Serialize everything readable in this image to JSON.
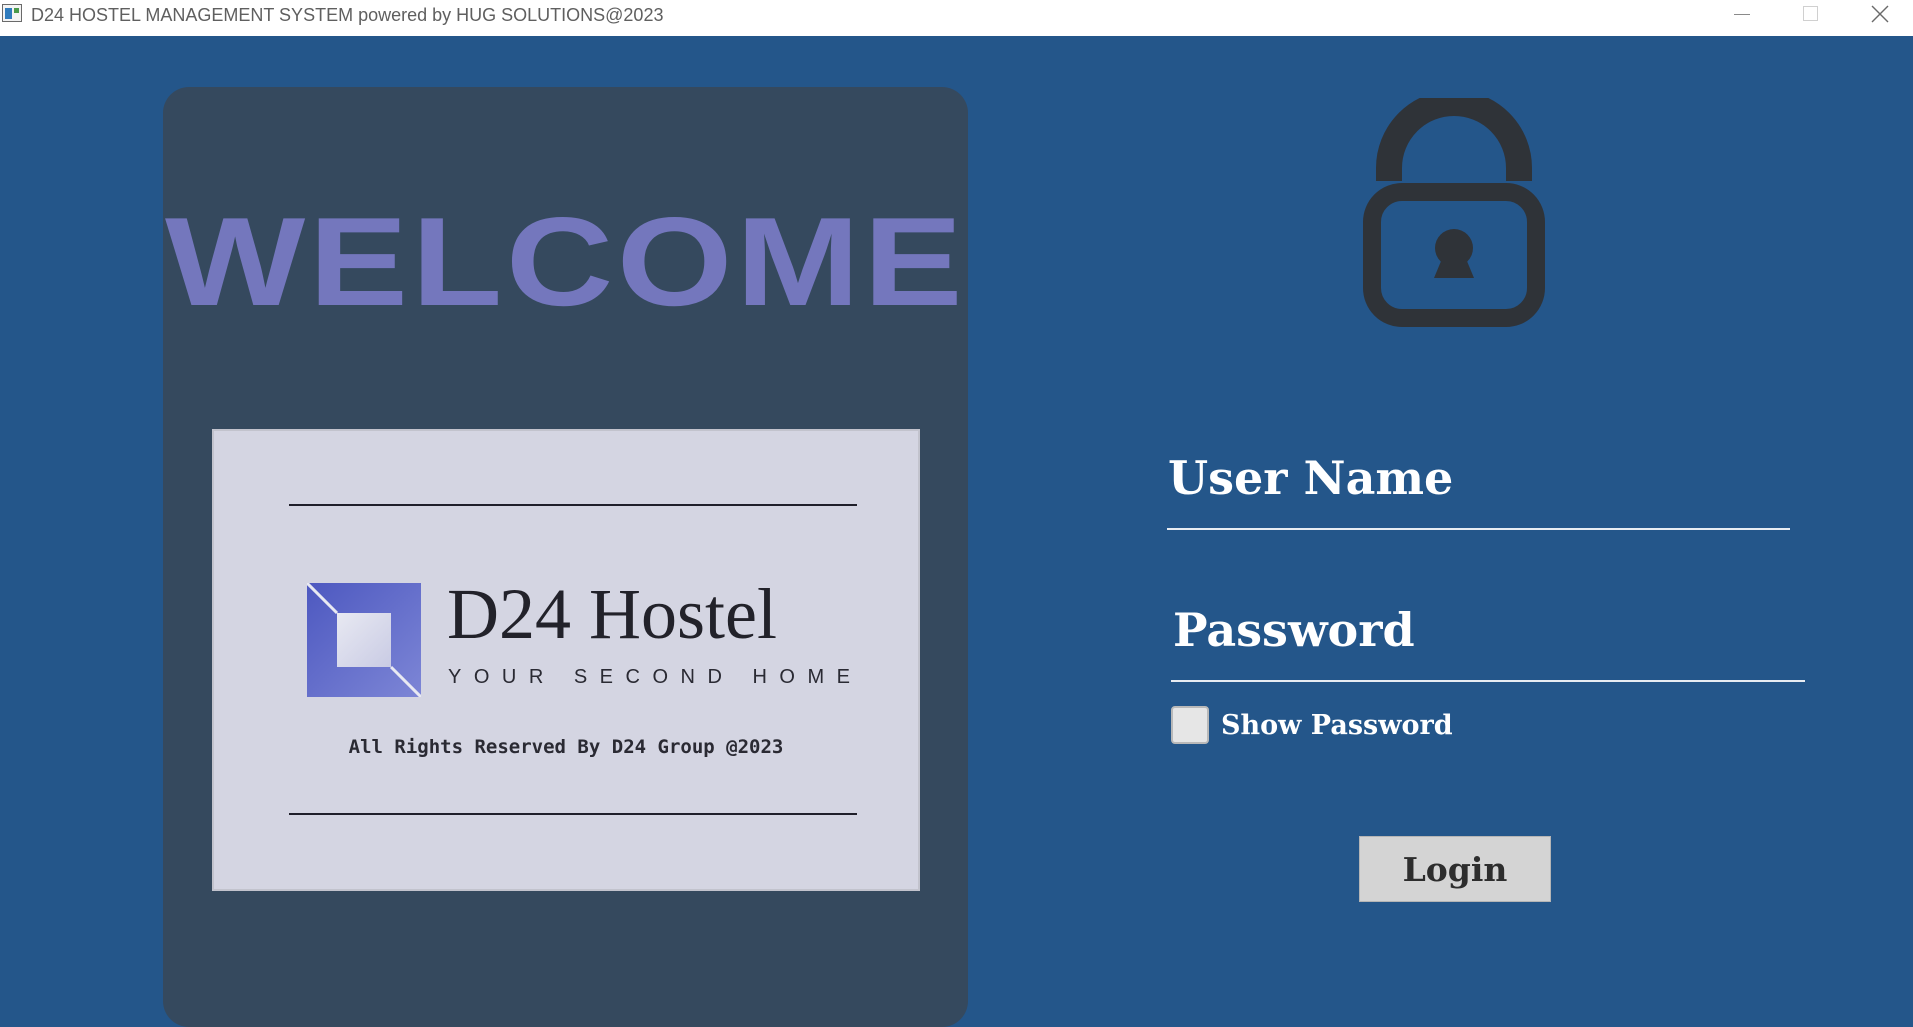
{
  "window": {
    "title": "D24 HOSTEL MANAGEMENT SYSTEM powered by HUG SOLUTIONS@2023",
    "controls": {
      "minimize_icon": "minimize-icon",
      "maximize_icon": "maximize-icon",
      "close_icon": "close-icon"
    }
  },
  "welcome_panel": {
    "heading": "WELCOME",
    "logo": {
      "name": "D24 Hostel",
      "tagline": "YOUR SECOND HOME",
      "rights": "All Rights Reserved By D24 Group @2023"
    }
  },
  "login_form": {
    "lock_icon": "padlock-icon",
    "username_label": "User Name",
    "username_value": "",
    "password_label": "Password",
    "password_value": "",
    "show_password_label": "Show Password",
    "show_password_checked": false,
    "login_button": "Login"
  },
  "colors": {
    "background": "#24568a",
    "panel": "#35495e",
    "welcome_text": "#7477bd",
    "logo_card": "#d4d5e2",
    "brand_blue": "#5a66c8"
  }
}
